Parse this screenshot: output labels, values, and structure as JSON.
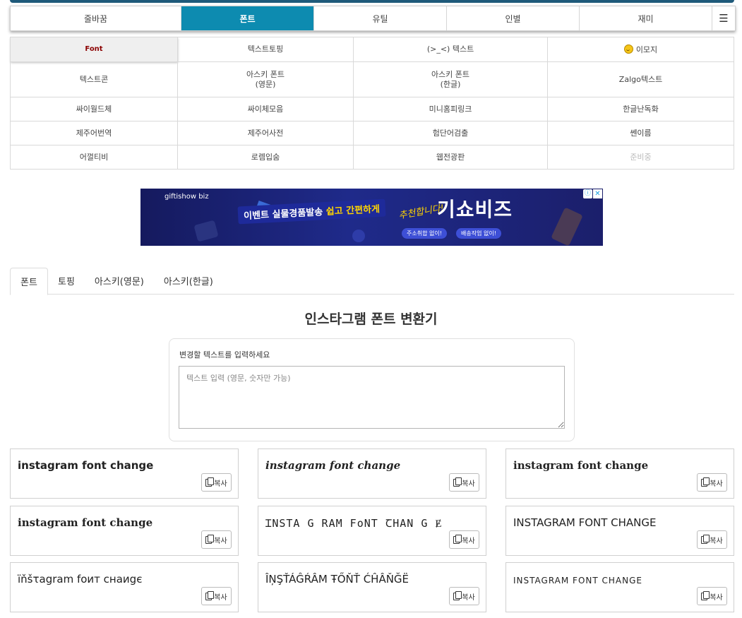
{
  "nav": {
    "items": [
      "줄바꿈",
      "폰트",
      "유틸",
      "인별",
      "재미"
    ],
    "active": "폰트",
    "menu_icon": "hamburger-icon"
  },
  "subnav": {
    "rows": [
      [
        "Font",
        "텍스트토핑",
        "(>_<) 텍스트",
        "이모지"
      ],
      [
        "텍스트콘",
        "아스키 폰트\n(영문)",
        "아스키 폰트\n(한글)",
        "Zalgo텍스트"
      ],
      [
        "싸이월드체",
        "싸이체모음",
        "미니홈피링크",
        "한글난독화"
      ],
      [
        "제주어번역",
        "제주어사전",
        "험단어검출",
        "쎈이름"
      ],
      [
        "어껄티비",
        "로렘입숨",
        "웹전광판",
        "준비중"
      ]
    ],
    "emoji_icon": "smiley-emoji-icon"
  },
  "ad": {
    "brand": "giftishow biz",
    "headline_pre": "이벤트 실물경품발송 ",
    "headline_hl": "쉽고 간편하게",
    "script": "추천합니다!",
    "name": "기쇼비즈",
    "pill1": "주소취합 없이!",
    "pill2": "배송작업 없이!",
    "info_icon": "ⓘ",
    "close_icon": "✕"
  },
  "tabs": [
    "폰트",
    "토핑",
    "아스키(영문)",
    "아스키(한글)"
  ],
  "title": "인스타그램 폰트 변환기",
  "input": {
    "label": "변경할 텍스트를 입력하세요",
    "placeholder": "텍스트 입력 (영문, 숫자만 가능)"
  },
  "results": [
    "instagram font change",
    "instagram font change",
    "instagram font change",
    "instagram font change",
    "ꞮNSTA G RAM FoNT ꞆHAN G Ɇ",
    "INSTAGRAM FONT CHANGE",
    "ïňšτagram foит снаиgє",
    "ÎŅŞŤÁĜŔÂM ŦŐŇŤ ĆĤÂŇĞË",
    "INSTAGRAM FONT CHANGE"
  ],
  "copy_label": "복사",
  "copy_icon": "copy-icon"
}
